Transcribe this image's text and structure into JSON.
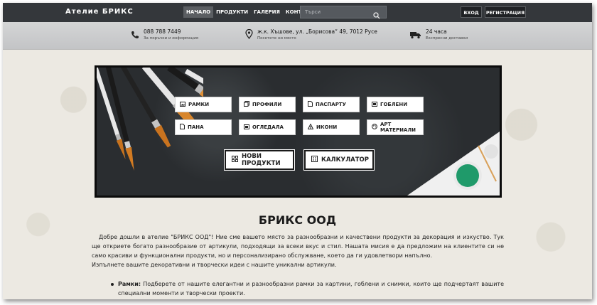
{
  "brand": "Ателие  БРИКС",
  "nav": [
    {
      "label": "НАЧАЛО",
      "active": true
    },
    {
      "label": "ПРОДУКТИ",
      "active": false
    },
    {
      "label": "ГАЛЕРИЯ",
      "active": false
    },
    {
      "label": "КОНТАКТИ",
      "active": false
    }
  ],
  "search": {
    "placeholder": "Търси"
  },
  "auth": {
    "login": "ВХОД",
    "register": "РЕГИСТРАЦИЯ"
  },
  "info": [
    {
      "icon": "phone-icon",
      "title": "088 788 7449",
      "subtitle": "За поръчки и информация"
    },
    {
      "icon": "map-pin-icon",
      "title": "ж.к. Хъшове, ул. „Борисова“ 49, 7012 Русе",
      "subtitle": "Посетете ни място"
    },
    {
      "icon": "truck-icon",
      "title": "24 часа",
      "subtitle": "Експресни доставки"
    }
  ],
  "categories": [
    {
      "label": "РАМКИ",
      "icon": "image-icon"
    },
    {
      "label": "ПРОФИЛИ",
      "icon": "layers-icon"
    },
    {
      "label": "ПАСПАРТУ",
      "icon": "file-icon"
    },
    {
      "label": "ГОБЛЕНИ",
      "icon": "picture-icon"
    },
    {
      "label": "ПАНА",
      "icon": "file-icon"
    },
    {
      "label": "ОГЛЕДАЛА",
      "icon": "mirror-icon"
    },
    {
      "label": "ИКОНИ",
      "icon": "cross-icon"
    },
    {
      "label": "АРТ МАТЕРИАЛИ",
      "icon": "palette-icon"
    }
  ],
  "actions": {
    "new_products": "НОВИ ПРОДУКТИ",
    "calculator": "КАЛКУЛАТОР"
  },
  "content": {
    "title": "БРИКС ООД",
    "intro": "Добре дошли в ателие \"БРИКС ООД\"! Ние сме вашето място за разнообразни и качествени продукти за декорация и изкуство. Тук ще откриете богато разнообразие от артикули, подходящи за всеки вкус и стил. Нашата мисия е да предложим на клиентите си не само красиви и функционални продукти, но и персонализирано обслужване, което да ги удовлетвори напълно.",
    "intro2": "Изпълнете вашите декоративни и творчески идеи с нашите уникални артикули.",
    "bullet_term": "Рамки:",
    "bullet_text": " Подберете от нашите елегантни и разнообразни рамки за картини, гоблени и снимки, които ще подчертаят вашите специални моменти и творчески проекти."
  }
}
